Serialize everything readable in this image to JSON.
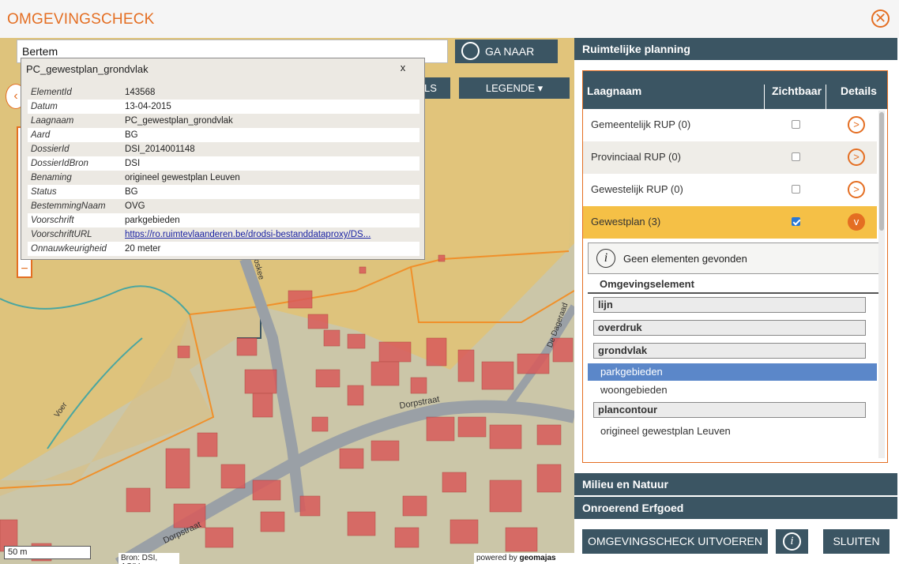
{
  "app": {
    "title": "OMGEVINGSCHECK",
    "close_label": "✕"
  },
  "search": {
    "value": "Bertem",
    "goto_label": "GA NAAR"
  },
  "map_tabs": {
    "tab1": "LS",
    "tab2": "LEGENDE ▾"
  },
  "map_controls": {
    "nav_left": "‹",
    "zoom_minus": "−"
  },
  "popup": {
    "title": "PC_gewestplan_grondvlak",
    "close_label": "x",
    "rows": [
      {
        "key": "ElementId",
        "value": "143568"
      },
      {
        "key": "Datum",
        "value": "13-04-2015"
      },
      {
        "key": "Laagnaam",
        "value": "PC_gewestplan_grondvlak"
      },
      {
        "key": "Aard",
        "value": "BG"
      },
      {
        "key": "DossierId",
        "value": "DSI_2014001148"
      },
      {
        "key": "DossierIdBron",
        "value": "DSI"
      },
      {
        "key": "Benaming",
        "value": "origineel gewestplan Leuven"
      },
      {
        "key": "Status",
        "value": "BG"
      },
      {
        "key": "BestemmingNaam",
        "value": "OVG"
      },
      {
        "key": "Voorschrift",
        "value": "parkgebieden"
      },
      {
        "key": "VoorschriftURL",
        "value": "https://ro.ruimtevlaanderen.be/drodsi-bestanddataproxy/DS..."
      },
      {
        "key": "Onnauwkeurigheid",
        "value": "20 meter"
      }
    ]
  },
  "map_footer": {
    "scale": "50 m",
    "attribution": "Bron: DSI, AGIV",
    "powered_by": "powered by ",
    "brand": "geomajas"
  },
  "map_labels": {
    "street1": "Dorpstraat",
    "street2": "Dorpstraat",
    "street3": "Boskee",
    "street4": "De Dageraad",
    "street5": "Voer"
  },
  "right_panel": {
    "section_ruimtelijke": "Ruimtelijke planning",
    "table_headers": {
      "laagnaam": "Laagnaam",
      "zichtbaar": "Zichtbaar",
      "details": "Details"
    },
    "layers": [
      {
        "name": "Gemeentelijk RUP (0)",
        "visible": false,
        "bg": "#ffffff"
      },
      {
        "name": "Provinciaal RUP (0)",
        "visible": false,
        "bg": "#efede8"
      },
      {
        "name": "Gewestelijk RUP (0)",
        "visible": false,
        "bg": "#ffffff"
      },
      {
        "name": "Gewestplan (3)",
        "visible": true,
        "bg": "#f5c046"
      }
    ],
    "info_text": "Geen elementen gevonden",
    "omgevingselement_label": "Omgevingselement",
    "groups": {
      "lijn": "lijn",
      "overdruk": "overdruk",
      "grondvlak": "grondvlak",
      "plancontour": "plancontour"
    },
    "items": {
      "parkgebieden": "parkgebieden",
      "woongebieden": "woongebieden",
      "origineel": "origineel gewestplan Leuven"
    },
    "section_milieu": "Milieu en Natuur",
    "section_erfgoed": "Onroerend Erfgoed",
    "btn_run": "OMGEVINGSCHECK UITVOEREN",
    "btn_close": "SLUITEN"
  },
  "colors": {
    "accent": "#e46e22",
    "header": "#3b5563",
    "selected": "#5b87c9",
    "highlight": "#f5c046"
  }
}
